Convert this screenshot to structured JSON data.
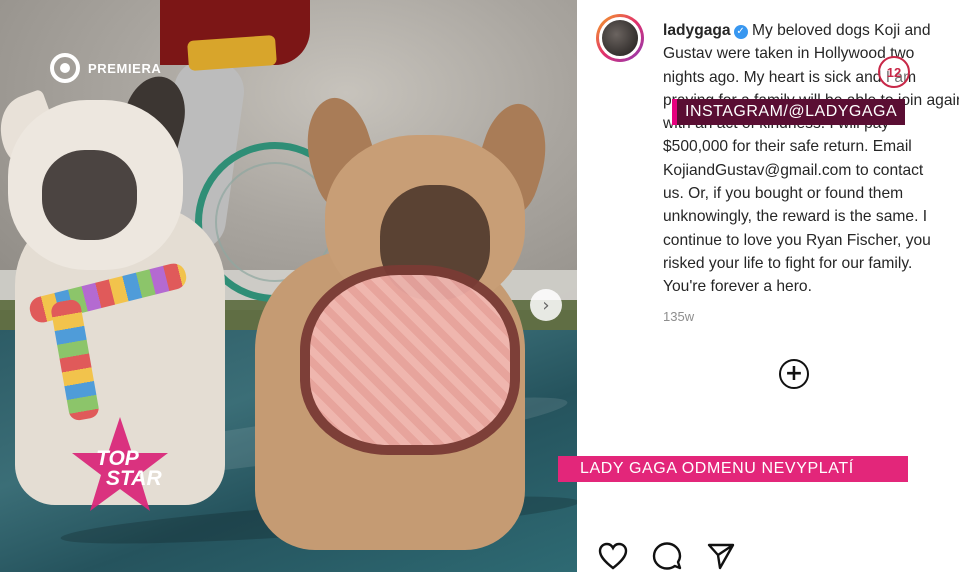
{
  "broadcast": {
    "channel_logo_text": "PREMIERA",
    "show_logo": {
      "line1": "TOP",
      "line2": "STAR"
    },
    "source_label": "INSTAGRAM/@LADYGAGA",
    "headline": "LADY GAGA ODMENU NEVYPLATÍ",
    "badge_number": "12"
  },
  "post": {
    "username": "ladygaga",
    "verified": true,
    "caption_lines": [
      "My beloved dogs Koji and",
      "Gustav were taken in Hollywood two",
      "nights ago. My heart is sick and I am",
      "praying for a family will be able to join again",
      "with an act of kindness. I will pay",
      "$500,000 for their safe return. Email",
      "KojiandGustav@gmail.com to contact",
      "us. Or, if you bought or found them",
      "unknowingly, the reward is the same. I",
      "continue to love you Ryan Fischer, you",
      "risked your life to fight for our family.",
      "You're forever a hero."
    ],
    "timestamp": "135w",
    "add_comment_symbol": "+",
    "carousel_next_symbol": "›",
    "actions": [
      "heart-icon",
      "comment-icon",
      "share-icon"
    ]
  },
  "colors": {
    "headline_bg": "#e3267a",
    "source_label_bg": "#5a0e33",
    "verified_blue": "#3897f0"
  }
}
